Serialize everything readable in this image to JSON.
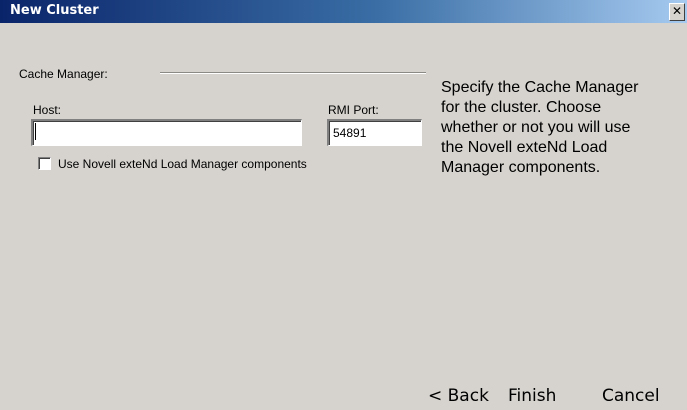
{
  "window": {
    "title": "New Cluster",
    "close_glyph": "✕"
  },
  "form": {
    "section_label": "Cache Manager:",
    "host_label": "Host:",
    "host_value": "",
    "port_label": "RMI Port:",
    "port_value": "54891",
    "load_manager_label": "Use Novell exteNd Load Manager components",
    "load_manager_checked": false
  },
  "help": {
    "lines": [
      "Specify the Cache Manager",
      "for the cluster.  Choose",
      "whether or not you will use",
      "the Novell exteNd Load",
      "Manager components."
    ]
  },
  "buttons": {
    "back": "< Back",
    "finish": "Finish",
    "cancel": "Cancel"
  },
  "icons": {
    "close": "close-icon"
  }
}
